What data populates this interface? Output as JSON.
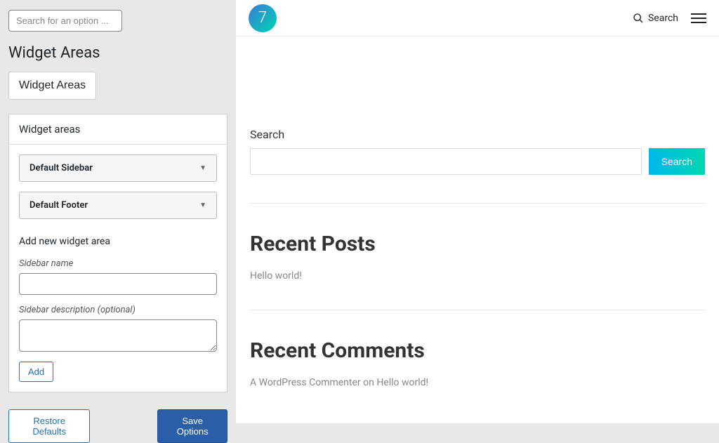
{
  "sidebar": {
    "search_placeholder": "Search for an option ...",
    "title": "Widget Areas",
    "tab_label": "Widget Areas",
    "panel_title": "Widget areas",
    "dropdowns": [
      {
        "label": "Default Sidebar"
      },
      {
        "label": "Default Footer"
      }
    ],
    "add_new_heading": "Add new widget area",
    "name_label": "Sidebar name",
    "desc_label": "Sidebar description (optional)",
    "add_button": "Add",
    "restore_button": "Restore Defaults",
    "save_button": "Save Options"
  },
  "main": {
    "logo_text": "7",
    "topbar_search": "Search",
    "search_label": "Search",
    "search_button": "Search",
    "recent_posts_title": "Recent Posts",
    "recent_posts_item": "Hello world!",
    "recent_comments_title": "Recent Comments",
    "recent_comments_item": "A WordPress Commenter on Hello world!"
  }
}
